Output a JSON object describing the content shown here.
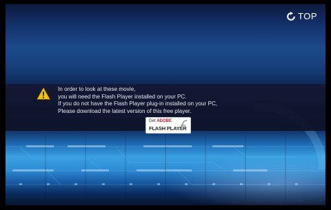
{
  "top_button": {
    "label": "TOP",
    "icon": "refresh-arrow-icon"
  },
  "message": {
    "icon": "warning-icon",
    "lines": [
      "In order to look at these movie,",
      "you will need the Flash Player installed on your PC.",
      "If you do not have the Flash Player plug-in installed on your PC,",
      "Please download the latest version of this free player."
    ]
  },
  "flash_badge": {
    "get": "Get",
    "adobe": "ADOBE",
    "product": "FLASH PLAYER"
  },
  "colors": {
    "band": "#141834",
    "accent_blue": "#3aa0e0",
    "warning_yellow": "#f5c400"
  }
}
